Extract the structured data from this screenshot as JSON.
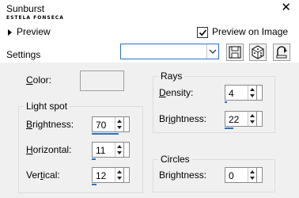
{
  "window": {
    "title": "Sunburst",
    "watermark": "ESTELA FONSECA",
    "close_glyph": "✕"
  },
  "header": {
    "preview_toggle_label": "Preview",
    "preview_on_image_label": "Preview on Image",
    "preview_on_image_checked": true
  },
  "settings": {
    "label": "Settings",
    "preset_value": "",
    "buttons": [
      "save-icon",
      "randomize-dice-icon",
      "reset-icon"
    ]
  },
  "color": {
    "label_underlined": "C",
    "label_rest": "olor:",
    "swatch": "#f0f0f0"
  },
  "light_spot": {
    "title": "Light spot",
    "brightness": {
      "u": "B",
      "rest": "rightness:",
      "value": "70",
      "level": 0.7
    },
    "horizontal": {
      "u": "H",
      "rest": "orizontal:",
      "value": "11",
      "level": 0.11
    },
    "vertical": {
      "pre": "Ver",
      "u": "t",
      "rest": "ical:",
      "value": "12",
      "level": 0.12
    }
  },
  "rays": {
    "title": "Rays",
    "density": {
      "u": "D",
      "rest": "ensity:",
      "value": "4",
      "level": 0.04
    },
    "brightness": {
      "pre": "Br",
      "u": "i",
      "rest": "ghtness:",
      "value": "22",
      "level": 0.22
    }
  },
  "circles": {
    "title": "Circles",
    "brightness": {
      "pre": "Bri",
      "u": "g",
      "rest": "htness:",
      "value": "0",
      "level": 0.0
    }
  },
  "colors": {
    "accent": "#2b72c9",
    "panel_bg": "#f0f0f0"
  }
}
